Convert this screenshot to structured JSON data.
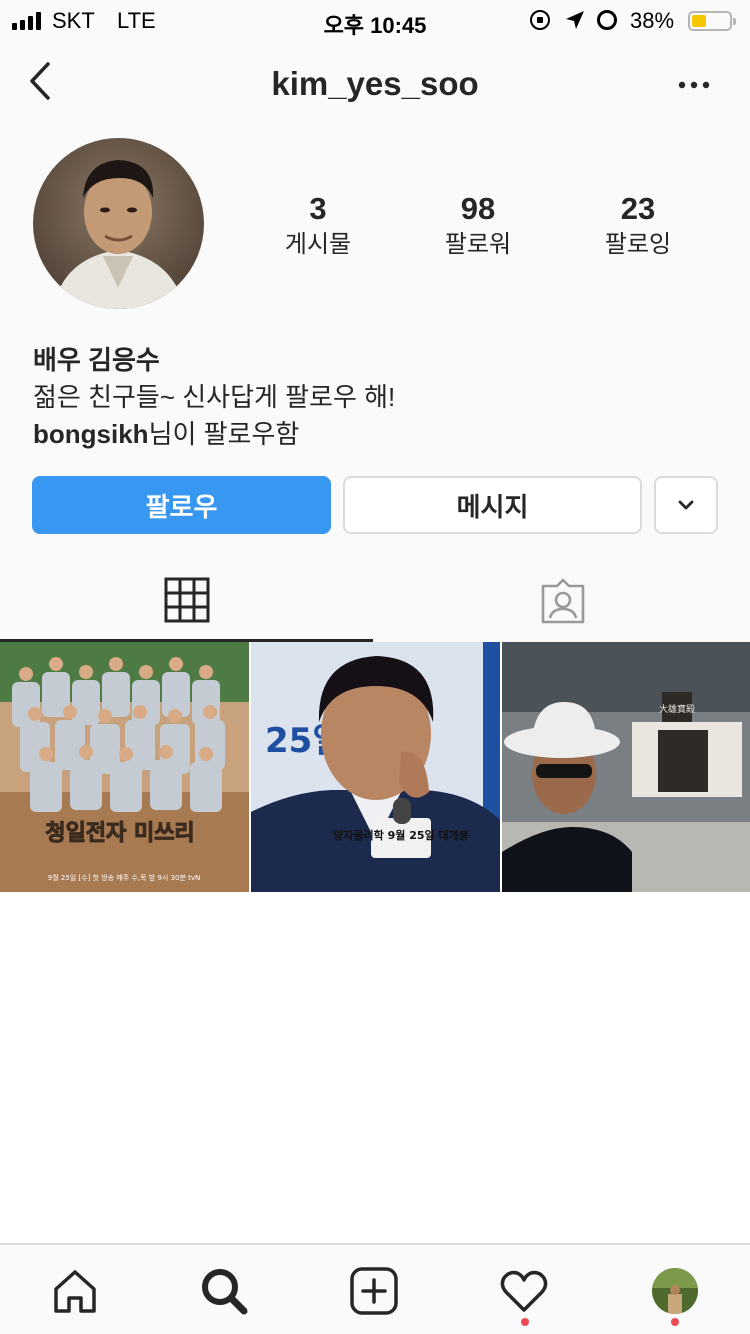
{
  "status_bar": {
    "carrier": "SKT",
    "network": "LTE",
    "time": "오후 10:45",
    "battery_percent": "38%",
    "battery_level": 0.38,
    "icons": [
      "orientation-lock-icon",
      "location-arrow-icon",
      "alarm-clock-icon"
    ]
  },
  "nav": {
    "username": "kim_yes_soo",
    "back_icon": "chevron-left-icon",
    "more_icon": "more-horizontal-icon"
  },
  "profile": {
    "stats": [
      {
        "value": "3",
        "label": "게시물"
      },
      {
        "value": "98",
        "label": "팔로워"
      },
      {
        "value": "23",
        "label": "팔로잉"
      }
    ],
    "name": "배우 김응수",
    "bio": "젊은 친구들~ 신사답게 팔로우 해!",
    "followed_by_user": "bongsikh",
    "followed_by_suffix": "님이 팔로우함"
  },
  "actions": {
    "follow_label": "팔로우",
    "message_label": "메시지",
    "dropdown_icon": "chevron-down-icon"
  },
  "tabs": [
    {
      "icon": "grid-icon",
      "active": true
    },
    {
      "icon": "tagged-person-icon",
      "active": false
    }
  ],
  "posts": [
    {
      "overlay_text": "청일전자 미쓰리",
      "caption": "9월 25일 [수] 첫 방송  매주 수,목 밤 9시 30분 tvN"
    },
    {
      "overlay_text": "25일",
      "caption": "양자물리학  9월 25일 대개봉"
    },
    {
      "overlay_text": "大雄寶殿",
      "caption": ""
    }
  ],
  "bottom_nav": [
    {
      "icon": "home-icon",
      "notify": false
    },
    {
      "icon": "search-icon",
      "notify": false
    },
    {
      "icon": "add-post-icon",
      "notify": false
    },
    {
      "icon": "heart-icon",
      "notify": true
    },
    {
      "icon": "profile-avatar-icon",
      "notify": true
    }
  ],
  "colors": {
    "accent": "#3897f0",
    "text": "#262626",
    "border": "#dbdbdb",
    "notify_dot": "#ed4956",
    "battery": "#f6c700"
  }
}
